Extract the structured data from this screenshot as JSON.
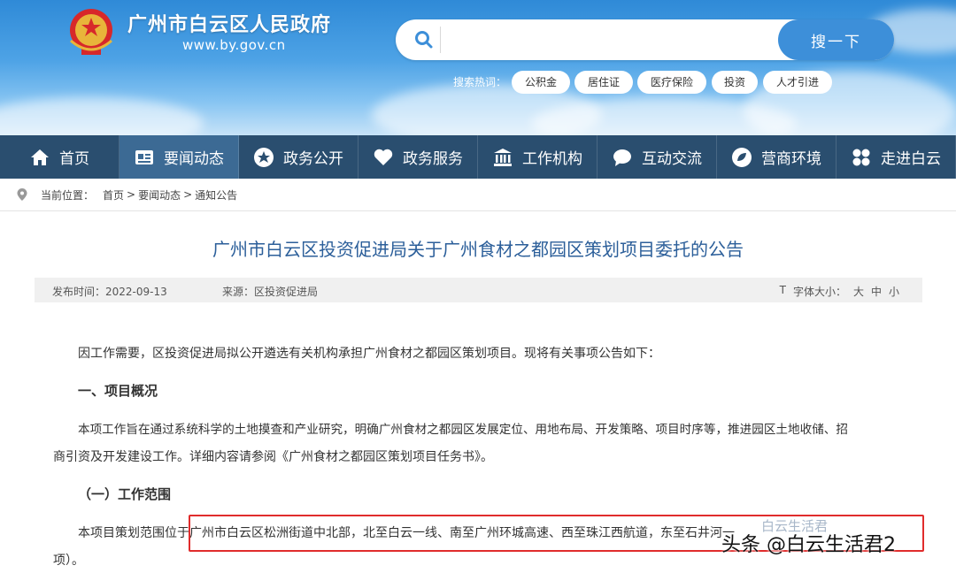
{
  "header": {
    "site_name": "广州市白云区人民政府",
    "site_url": "www.by.gov.cn"
  },
  "search": {
    "placeholder": "",
    "button_label": "搜一下",
    "hot_label": "搜索热词：",
    "hot_tags": [
      "公积金",
      "居住证",
      "医疗保险",
      "投资",
      "人才引进"
    ]
  },
  "nav": {
    "items": [
      {
        "label": "首页",
        "icon": "home-icon"
      },
      {
        "label": "要闻动态",
        "icon": "news-icon"
      },
      {
        "label": "政务公开",
        "icon": "star-icon"
      },
      {
        "label": "政务服务",
        "icon": "heart-icon"
      },
      {
        "label": "工作机构",
        "icon": "building-icon"
      },
      {
        "label": "互动交流",
        "icon": "chat-icon"
      },
      {
        "label": "营商环境",
        "icon": "leaf-icon"
      },
      {
        "label": "走进白云",
        "icon": "grid-icon"
      }
    ],
    "active_index": 1
  },
  "breadcrumb": {
    "prefix": "当前位置：",
    "items": [
      "首页",
      "要闻动态",
      "通知公告"
    ],
    "separator": ">"
  },
  "article": {
    "title": "广州市白云区投资促进局关于广州食材之都园区策划项目委托的公告",
    "date": "发布时间：2022-09-13",
    "source": "来源：区投资促进局",
    "font_size_label": "字体大小：",
    "font_sizes": [
      "大",
      "中",
      "小"
    ],
    "para1": "因工作需要，区投资促进局拟公开遴选有关机构承担广州食材之都园区策划项目。现将有关事项公告如下：",
    "heading1": "一、项目概况",
    "para2_line1": "本项工作旨在通过系统科学的土地摸查和产业研究，明确广州食材之都园区发展定位、用地布局、开发策略、项目时序等，推进园区土地收储、招",
    "para2_line2": "商引资及开发建设工作。详细内容请参阅《广州食材之都园区策划项目任务书》。",
    "heading2": "（一）工作范围",
    "para3_line1": "本项目策划范围位于广州市白云区松洲街道中北部，北至白云一线、南至广州环城高速、西至珠江西航道，东至石井河一",
    "para3_line2": "项）。"
  },
  "watermark": {
    "text": "头条 @白云生活君2",
    "faint_text": "白云生活君"
  },
  "colors": {
    "nav_bg": "#2a4e6f",
    "nav_active": "#3c6a94",
    "title": "#2c5f9a",
    "highlight": "#e02c2c",
    "search_button": "#3d8fd9"
  }
}
